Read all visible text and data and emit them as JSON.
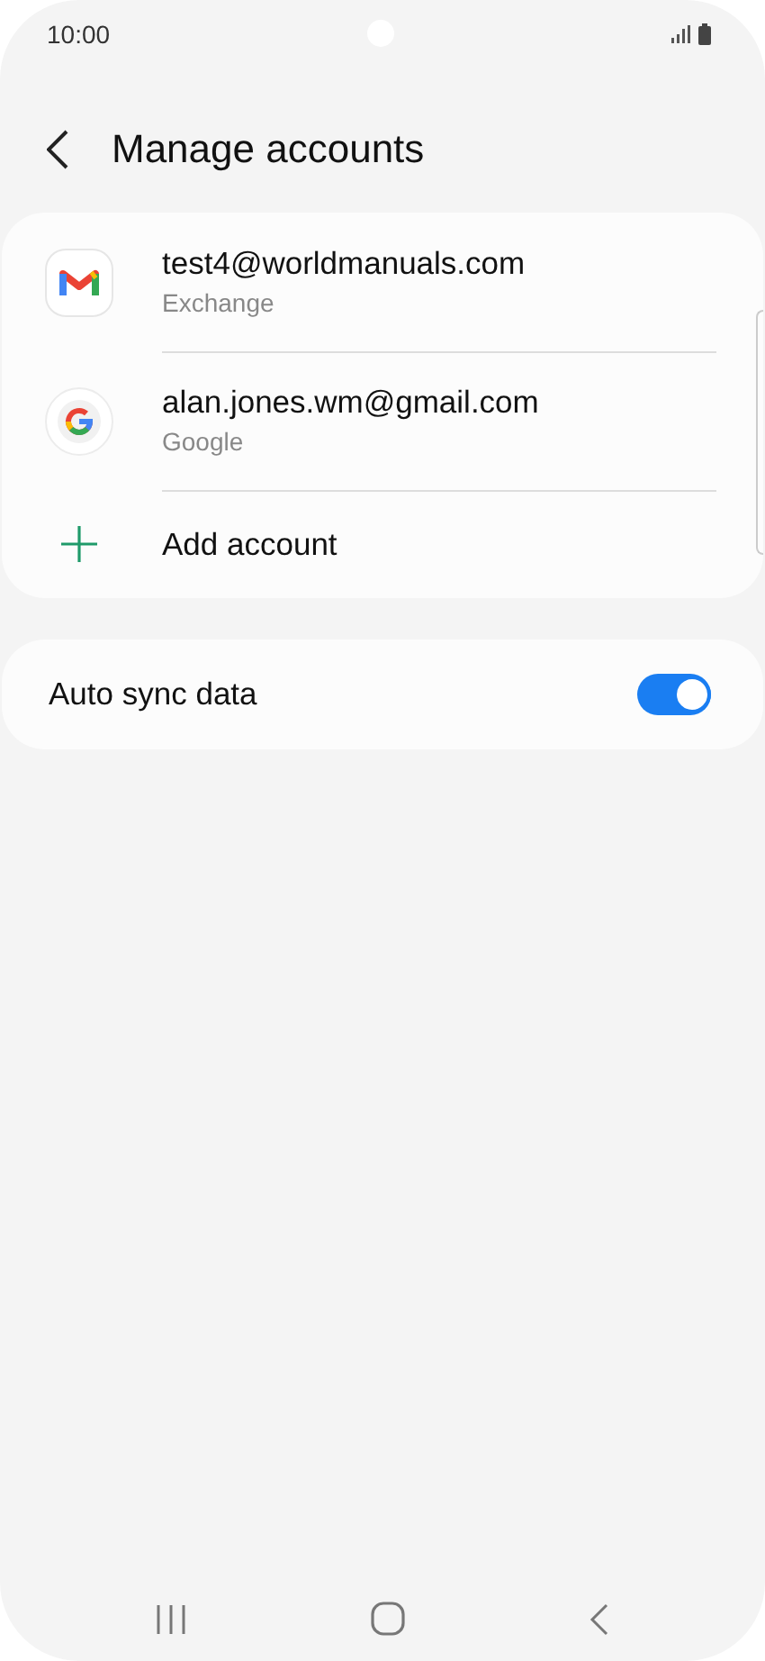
{
  "status_bar": {
    "time": "10:00"
  },
  "header": {
    "title": "Manage accounts"
  },
  "accounts": [
    {
      "kind": "gmail",
      "address": "test4@worldmanuals.com",
      "type": "Exchange"
    },
    {
      "kind": "google",
      "address": "alan.jones.wm@gmail.com",
      "type": "Google"
    }
  ],
  "add_account": {
    "label": "Add account"
  },
  "auto_sync": {
    "label": "Auto sync data",
    "on": true
  }
}
